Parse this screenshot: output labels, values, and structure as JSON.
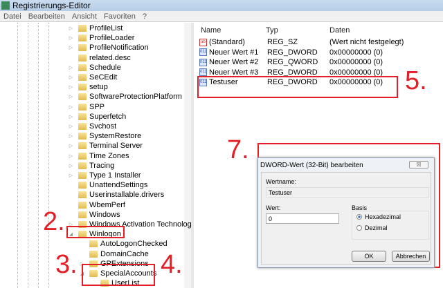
{
  "window": {
    "title": "Registrierungs-Editor"
  },
  "menu": [
    "Datei",
    "Bearbeiten",
    "Ansicht",
    "Favoriten",
    "?"
  ],
  "tree": [
    {
      "label": "ProfileList",
      "exp": "▷"
    },
    {
      "label": "ProfileLoader",
      "exp": "▷"
    },
    {
      "label": "ProfileNotification",
      "exp": "▷"
    },
    {
      "label": "related.desc",
      "exp": ""
    },
    {
      "label": "Schedule",
      "exp": "▷"
    },
    {
      "label": "SeCEdit",
      "exp": "▷"
    },
    {
      "label": "setup",
      "exp": "▷"
    },
    {
      "label": "SoftwareProtectionPlatform",
      "exp": "▷"
    },
    {
      "label": "SPP",
      "exp": "▷"
    },
    {
      "label": "Superfetch",
      "exp": "▷"
    },
    {
      "label": "Svchost",
      "exp": "▷"
    },
    {
      "label": "SystemRestore",
      "exp": "▷"
    },
    {
      "label": "Terminal Server",
      "exp": "▷"
    },
    {
      "label": "Time Zones",
      "exp": "▷"
    },
    {
      "label": "Tracing",
      "exp": "▷"
    },
    {
      "label": "Type 1 Installer",
      "exp": "▷"
    },
    {
      "label": "UnattendSettings",
      "exp": ""
    },
    {
      "label": "Userinstallable.drivers",
      "exp": ""
    },
    {
      "label": "WbemPerf",
      "exp": ""
    },
    {
      "label": "Windows",
      "exp": ""
    },
    {
      "label": "Windows Activation Technologies",
      "exp": "▷"
    },
    {
      "label": "Winlogon",
      "exp": "◢"
    },
    {
      "label": "AutoLogonChecked",
      "exp": "",
      "indent": 1
    },
    {
      "label": "DomainCache",
      "exp": "",
      "indent": 1
    },
    {
      "label": "GPExtensions",
      "exp": "▷",
      "indent": 1
    },
    {
      "label": "SpecialAccounts",
      "exp": "◢",
      "indent": 1
    },
    {
      "label": "UserList",
      "exp": "",
      "indent": 2
    }
  ],
  "list": {
    "headers": [
      "Name",
      "Typ",
      "Daten"
    ],
    "rows": [
      {
        "name": "(Standard)",
        "type": "REG_SZ",
        "data": "(Wert nicht festgelegt)",
        "icon": "ab"
      },
      {
        "name": "Neuer Wert #1",
        "type": "REG_DWORD",
        "data": "0x00000000 (0)",
        "icon": "011"
      },
      {
        "name": "Neuer Wert #2",
        "type": "REG_QWORD",
        "data": "0x00000000 (0)",
        "icon": "011"
      },
      {
        "name": "Neuer Wert #3",
        "type": "REG_DWORD",
        "data": "0x00000000 (0)",
        "icon": "011"
      },
      {
        "name": "Testuser",
        "type": "REG_DWORD",
        "data": "0x00000000 (0)",
        "icon": "011"
      }
    ]
  },
  "dialog": {
    "title": "DWORD-Wert (32-Bit) bearbeiten",
    "close": "☒",
    "name_label": "Wertname:",
    "name_value": "Testuser",
    "value_label": "Wert:",
    "value": "0",
    "base_label": "Basis",
    "hex": "Hexadezimal",
    "dec": "Dezimal",
    "ok": "OK",
    "cancel": "Abbrechen"
  },
  "annotations": [
    "2.",
    "3.",
    "4.",
    "5.",
    "7."
  ],
  "colors": {
    "annotation": "#e41e26"
  }
}
